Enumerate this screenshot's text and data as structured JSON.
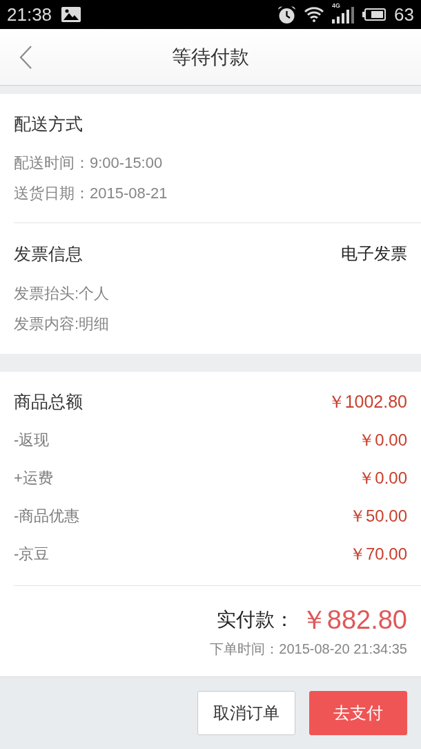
{
  "status_bar": {
    "time": "21:38",
    "network": "4G",
    "battery": "63"
  },
  "nav": {
    "title": "等待付款"
  },
  "delivery": {
    "title": "配送方式",
    "lines": [
      "配送时间：9:00-15:00",
      "送货日期：2015-08-21"
    ]
  },
  "invoice": {
    "title": "发票信息",
    "type": "电子发票",
    "lines": [
      "发票抬头:个人",
      "发票内容:明细"
    ]
  },
  "amounts": {
    "rows": [
      {
        "kind": "total",
        "label": "商品总额",
        "value": "￥1002.80"
      },
      {
        "kind": "item",
        "label": "-返现",
        "value": "￥0.00"
      },
      {
        "kind": "item",
        "label": "+运费",
        "value": "￥0.00"
      },
      {
        "kind": "item",
        "label": "-商品优惠",
        "value": "￥50.00"
      },
      {
        "kind": "item",
        "label": "-京豆",
        "value": "￥70.00"
      }
    ]
  },
  "payment": {
    "label": "实付款：",
    "value": "￥882.80",
    "order_time": "下单时间：2015-08-20 21:34:35"
  },
  "actions": [
    {
      "kind": "secondary",
      "label": "取消订单"
    },
    {
      "kind": "primary",
      "label": "去支付"
    }
  ]
}
